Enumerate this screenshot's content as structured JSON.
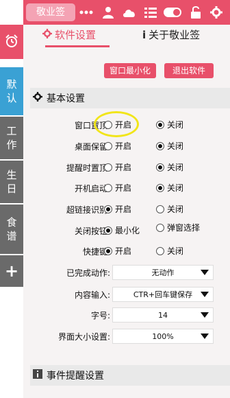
{
  "app": {
    "brand": "敬业签"
  },
  "topbar": {
    "icons": [
      "more-icon",
      "user-icon",
      "cloud-icon",
      "list-icon",
      "toggle-icon",
      "unlock-icon",
      "settings-icon"
    ]
  },
  "sidebar": {
    "alarm_icon": "alarm-icon",
    "tabs": [
      {
        "label_lines": [
          "默",
          "认"
        ],
        "active": true
      },
      {
        "label_lines": [
          "工",
          "作"
        ]
      },
      {
        "label_lines": [
          "生",
          "日"
        ]
      },
      {
        "label_lines": [
          "食",
          "谱"
        ]
      }
    ],
    "add_label": "+"
  },
  "tabs": {
    "software_settings": "软件设置",
    "about": "关于敬业签"
  },
  "buttons": {
    "minimize": "窗口最小化",
    "exit": "退出软件"
  },
  "sections": {
    "basic": "基本设置",
    "event_reminder": "事件提醒设置"
  },
  "settings": {
    "window_top": {
      "label": "窗口置顶:",
      "on": "开启",
      "off": "关闭",
      "value": "off"
    },
    "desktop_keep": {
      "label": "桌面保留:",
      "on": "开启",
      "off": "关闭",
      "value": "off"
    },
    "reminder_top": {
      "label": "提醒时置顶:",
      "on": "开启",
      "off": "关闭",
      "value": "off"
    },
    "autostart": {
      "label": "开机启动:",
      "on": "开启",
      "off": "关闭",
      "value": "off"
    },
    "hyperlink": {
      "label": "超链接识别:",
      "on": "开启",
      "off": "关闭",
      "value": "on"
    },
    "close_button": {
      "label": "关闭按钮:",
      "on": "最小化",
      "off": "弹窗选择",
      "value": "on"
    },
    "shortcut": {
      "label": "快捷键:",
      "on": "开启",
      "off": "关闭",
      "value": "on"
    },
    "completed_action": {
      "label": "已完成动作:",
      "value": "无动作"
    },
    "content_input": {
      "label": "内容输入:",
      "value": "CTR+回车键保存"
    },
    "font_size": {
      "label": "字号:",
      "value": "14"
    },
    "ui_size": {
      "label": "界面大小设置:",
      "value": "100%"
    }
  },
  "colors": {
    "accent": "#e8506a",
    "active_tab": "#3aa1d4",
    "inactive_tab": "#6a6a6a",
    "highlight": "#f1e51a"
  }
}
